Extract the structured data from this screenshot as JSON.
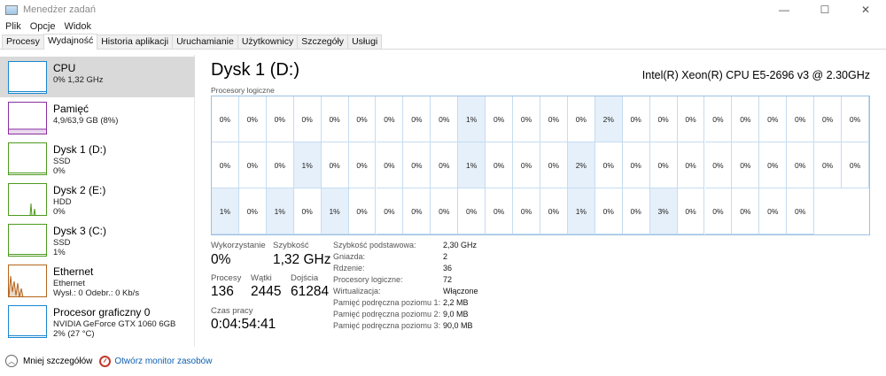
{
  "window": {
    "title": "Menedżer zadań",
    "minimize_glyph": "—",
    "maximize_glyph": "☐",
    "close_glyph": "✕"
  },
  "menu": [
    "Plik",
    "Opcje",
    "Widok"
  ],
  "tabs": [
    {
      "label": "Procesy",
      "active": false
    },
    {
      "label": "Wydajność",
      "active": true
    },
    {
      "label": "Historia aplikacji",
      "active": false
    },
    {
      "label": "Uruchamianie",
      "active": false
    },
    {
      "label": "Użytkownicy",
      "active": false
    },
    {
      "label": "Szczegóły",
      "active": false
    },
    {
      "label": "Usługi",
      "active": false
    }
  ],
  "sidebar": {
    "items": [
      {
        "title": "CPU",
        "sub1": "0% 1,32 GHz",
        "sub2": "",
        "selected": true,
        "color": "#1a86d0",
        "graph": "flat"
      },
      {
        "title": "Pamięć",
        "sub1": "4,9/63,9 GB (8%)",
        "sub2": "",
        "selected": false,
        "color": "#8b2fa0",
        "graph": "mem"
      },
      {
        "title": "Dysk 1 (D:)",
        "sub1": "SSD",
        "sub2": "0%",
        "selected": false,
        "color": "#4d9a1e",
        "graph": "flat"
      },
      {
        "title": "Dysk 2 (E:)",
        "sub1": "HDD",
        "sub2": "0%",
        "selected": false,
        "color": "#4d9a1e",
        "graph": "spike"
      },
      {
        "title": "Dysk 3 (C:)",
        "sub1": "SSD",
        "sub2": "1%",
        "selected": false,
        "color": "#4d9a1e",
        "graph": "flat"
      },
      {
        "title": "Ethernet",
        "sub1": "Ethernet",
        "sub2": "Wysł.: 0 Odebr.: 0 Kb/s",
        "selected": false,
        "color": "#b5651d",
        "graph": "eth"
      },
      {
        "title": "Procesor graficzny 0",
        "sub1": "NVIDIA GeForce GTX 1060 6GB",
        "sub2": "2% (27 °C)",
        "selected": false,
        "color": "#1a86d0",
        "graph": "flat"
      }
    ]
  },
  "main": {
    "title": "Dysk 1 (D:)",
    "cpu_model": "Intel(R) Xeon(R) CPU E5-2696 v3 @ 2.30GHz",
    "grid_label": "Procesory logiczne",
    "cpu_grid": {
      "rows": [
        [
          "0%",
          "0%",
          "0%",
          "0%",
          "0%",
          "0%",
          "0%",
          "0%",
          "0%",
          "1%",
          "0%",
          "0%",
          "0%",
          "0%",
          "2%",
          "0%",
          "0%",
          "0%",
          "0%",
          "0%",
          "0%",
          "0%",
          "0%",
          "0%"
        ],
        [
          "0%",
          "0%",
          "0%",
          "1%",
          "0%",
          "0%",
          "0%",
          "0%",
          "0%",
          "1%",
          "0%",
          "0%",
          "0%",
          "2%",
          "0%",
          "0%",
          "0%",
          "0%",
          "0%",
          "0%",
          "0%",
          "0%",
          "0%",
          "0%"
        ],
        [
          "1%",
          "0%",
          "1%",
          "0%",
          "1%",
          "0%",
          "0%",
          "0%",
          "0%",
          "0%",
          "0%",
          "0%",
          "0%",
          "1%",
          "0%",
          "0%",
          "3%",
          "0%",
          "0%",
          "0%",
          "0%",
          "0%",
          "",
          ""
        ]
      ],
      "highlighted": [
        [
          9,
          14
        ],
        [
          3,
          9,
          13
        ],
        [
          0,
          2,
          4,
          13,
          16
        ]
      ]
    },
    "stats": {
      "utilization_label": "Wykorzystanie",
      "utilization_value": "0%",
      "speed_label": "Szybkość",
      "speed_value": "1,32 GHz",
      "processes_label": "Procesy",
      "processes_value": "136",
      "threads_label": "Wątki",
      "threads_value": "2445",
      "handles_label": "Dojścia",
      "handles_value": "61284",
      "uptime_label": "Czas pracy",
      "uptime_value": "0:04:54:41"
    },
    "info": [
      {
        "label": "Szybkość podstawowa:",
        "value": "2,30 GHz"
      },
      {
        "label": "Gniazda:",
        "value": "2"
      },
      {
        "label": "Rdzenie:",
        "value": "36"
      },
      {
        "label": "Procesory logiczne:",
        "value": "72"
      },
      {
        "label": "Wirtualizacja:",
        "value": "Włączone"
      },
      {
        "label": "Pamięć podręczna poziomu 1:",
        "value": "2,2 MB"
      },
      {
        "label": "Pamięć podręczna poziomu 2:",
        "value": "9,0 MB"
      },
      {
        "label": "Pamięć podręczna poziomu 3:",
        "value": "90,0 MB"
      }
    ]
  },
  "bottom": {
    "fewer_details": "Mniej szczegółów",
    "resource_monitor": "Otwórz monitor zasobów"
  },
  "icons": {
    "app": "task-manager-icon",
    "fewer": "chevron-up-icon",
    "monitor": "resource-monitor-icon"
  }
}
